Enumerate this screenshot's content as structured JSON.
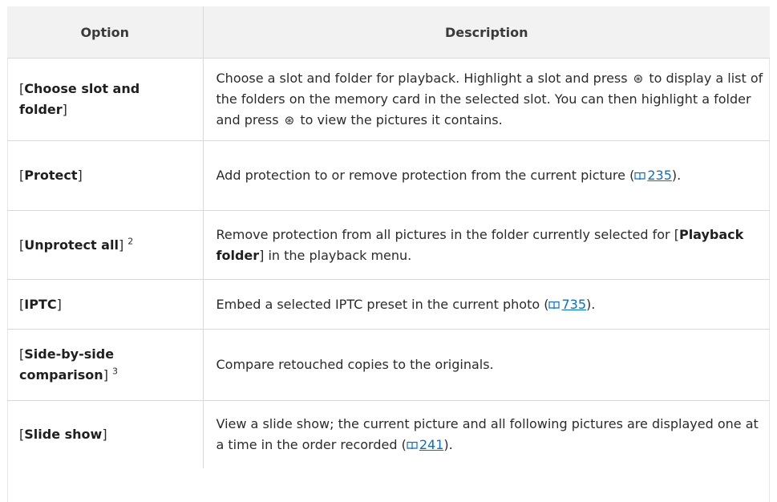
{
  "table": {
    "headers": [
      "Option",
      "Description"
    ],
    "rows": [
      {
        "option": "Choose slot and folder",
        "description": {
          "p1": "Choose a slot and folder for playback. Highlight a slot and press ",
          "glyph1": "⊛",
          "p2": " to display a list of the folders on the memory card in the selected slot. You can then highlight a folder and press ",
          "glyph2": "⊛",
          "p3": " to view the pictures it contains."
        }
      },
      {
        "option": "Protect",
        "description": {
          "p1": "Add protection to or remove protection from the current picture (",
          "ref": "235",
          "p2": ")."
        }
      },
      {
        "option": "Unprotect all",
        "footnote": "2",
        "description": {
          "p1": "Remove protection from all pictures in the folder currently selected for [",
          "bold": "Playback folder",
          "p2": "] in the playback menu."
        }
      },
      {
        "option": "IPTC",
        "description": {
          "p1": "Embed a selected IPTC preset in the current photo (",
          "ref": "735",
          "p2": ")."
        }
      },
      {
        "option": "Side-by-side comparison",
        "footnote": "3",
        "description": {
          "p1": "Compare retouched copies to the originals."
        }
      },
      {
        "option": "Slide show",
        "description": {
          "p1": "View a slide show; the current picture and all following pictures are displayed one at a time in the order recorded (",
          "ref": "241",
          "p2": ")."
        }
      }
    ],
    "bracket_open": "[",
    "bracket_close": "]"
  },
  "colors": {
    "header_bg": "#f2f2f2",
    "border": "#d9d9d9",
    "link": "#0a6fc2",
    "text": "#2b2b2b"
  },
  "icons": {
    "book": "book-icon",
    "multi_selector_right": "multi-selector-right-icon",
    "ok_button": "ok-button-icon"
  }
}
